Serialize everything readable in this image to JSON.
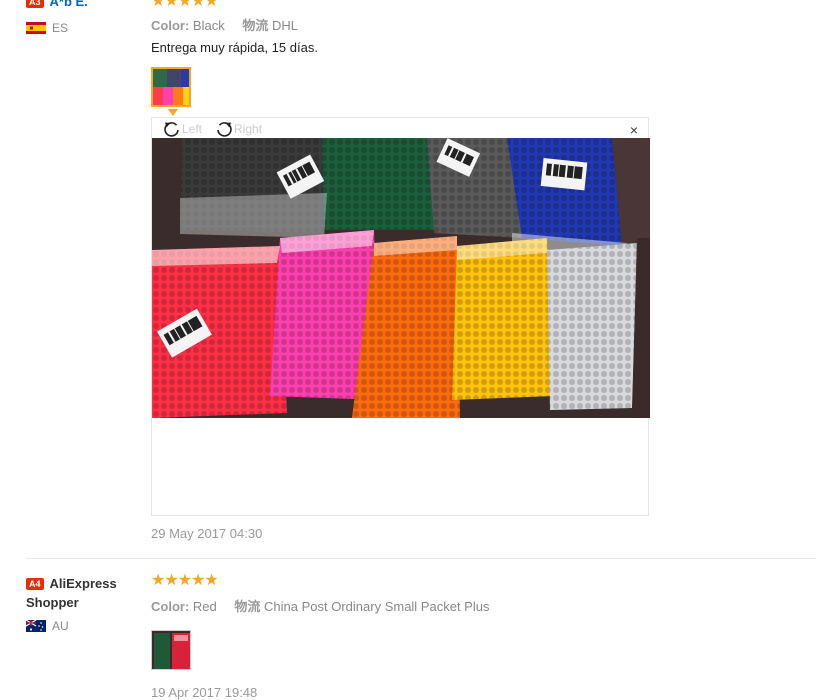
{
  "reviews": [
    {
      "level": "A3",
      "user": "A*b E.",
      "country": "ES",
      "stars": "★★★★★",
      "color_key": "Color:",
      "color_value": "Black",
      "shipping_key": "物流",
      "shipping_value": "DHL",
      "text": "Entrega muy rápida, 15 días.",
      "date": "29 May 2017 04:30",
      "viewer": {
        "left_label": "Left",
        "right_label": "Right",
        "close": "×"
      }
    },
    {
      "level": "A4",
      "user": "AliExpress Shopper",
      "country": "AU",
      "stars": "★★★★★",
      "color_key": "Color:",
      "color_value": "Red",
      "shipping_key": "物流",
      "shipping_value": "China Post Ordinary Small Packet Plus",
      "date": "19 Apr 2017 19:48"
    }
  ],
  "colors": {
    "accent_user": "#0066c0",
    "star": "#f5a623",
    "badge": "#e62e04"
  },
  "icons": {
    "rotate_left": "rotate-left-icon",
    "rotate_right": "rotate-right-icon",
    "close": "close-icon"
  }
}
